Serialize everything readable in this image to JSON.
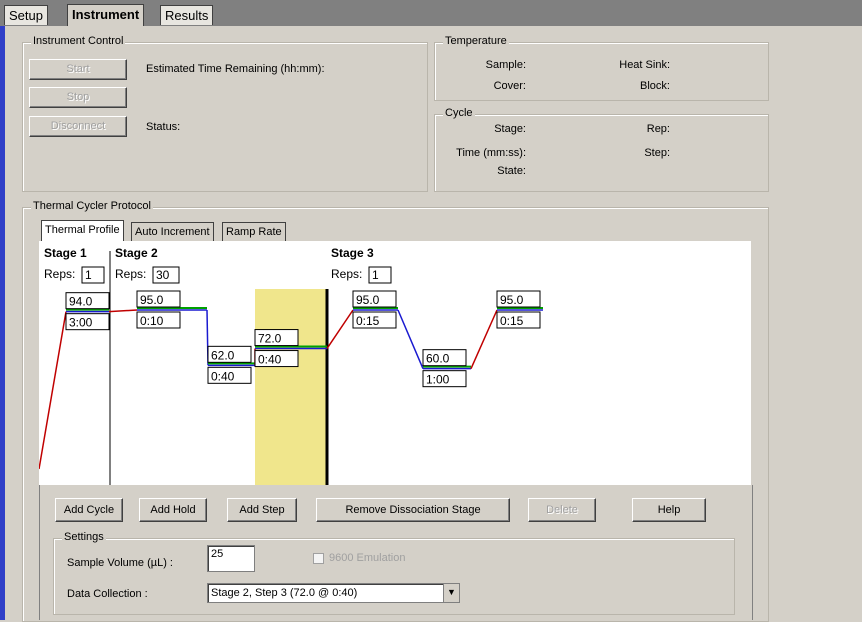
{
  "tabs": [
    "Setup",
    "Instrument",
    "Results"
  ],
  "instrument_control": {
    "title": "Instrument Control",
    "start_label": "Start",
    "stop_label": "Stop",
    "disconnect_label": "Disconnect",
    "time_remaining_label": "Estimated Time Remaining (hh:mm):",
    "status_label": "Status:"
  },
  "temperature": {
    "title": "Temperature",
    "sample_label": "Sample:",
    "heat_sink_label": "Heat Sink:",
    "cover_label": "Cover:",
    "block_label": "Block:"
  },
  "cycle": {
    "title": "Cycle",
    "stage_label": "Stage:",
    "rep_label": "Rep:",
    "time_label": "Time (mm:ss):",
    "step_label": "Step:",
    "state_label": "State:"
  },
  "protocol": {
    "title": "Thermal Cycler Protocol",
    "inner_tabs": [
      "Thermal Profile",
      "Auto Increment",
      "Ramp Rate"
    ],
    "reps_label": "Reps:",
    "stages": [
      {
        "name": "Stage 1",
        "reps": "1",
        "steps": [
          {
            "temp": "94.0",
            "time": "3:00"
          }
        ]
      },
      {
        "name": "Stage 2",
        "reps": "30",
        "steps": [
          {
            "temp": "95.0",
            "time": "0:10"
          },
          {
            "temp": "62.0",
            "time": "0:40"
          },
          {
            "temp": "72.0",
            "time": "0:40"
          }
        ]
      },
      {
        "name": "Stage 3",
        "reps": "1",
        "steps": [
          {
            "temp": "95.0",
            "time": "0:15"
          },
          {
            "temp": "60.0",
            "time": "1:00"
          },
          {
            "temp": "95.0",
            "time": "0:15"
          }
        ]
      }
    ],
    "selected_step": "Stage 2, Step 3",
    "colors": {
      "ramp_up": "#c00000",
      "ramp_down": "#1a1ad0",
      "hold": "#00a000",
      "selected": "#f0e68c"
    }
  },
  "actions": {
    "add_cycle": "Add Cycle",
    "add_hold": "Add Hold",
    "add_step": "Add Step",
    "remove_dissociation": "Remove Dissociation Stage",
    "delete": "Delete",
    "help": "Help"
  },
  "settings": {
    "title": "Settings",
    "sample_volume_label": "Sample Volume (µL) :",
    "sample_volume_value": "25",
    "emulation_label": "9600 Emulation",
    "emulation_checked": false,
    "data_collection_label": "Data Collection :",
    "data_collection_value": "Stage 2, Step 3 (72.0 @ 0:40)"
  }
}
